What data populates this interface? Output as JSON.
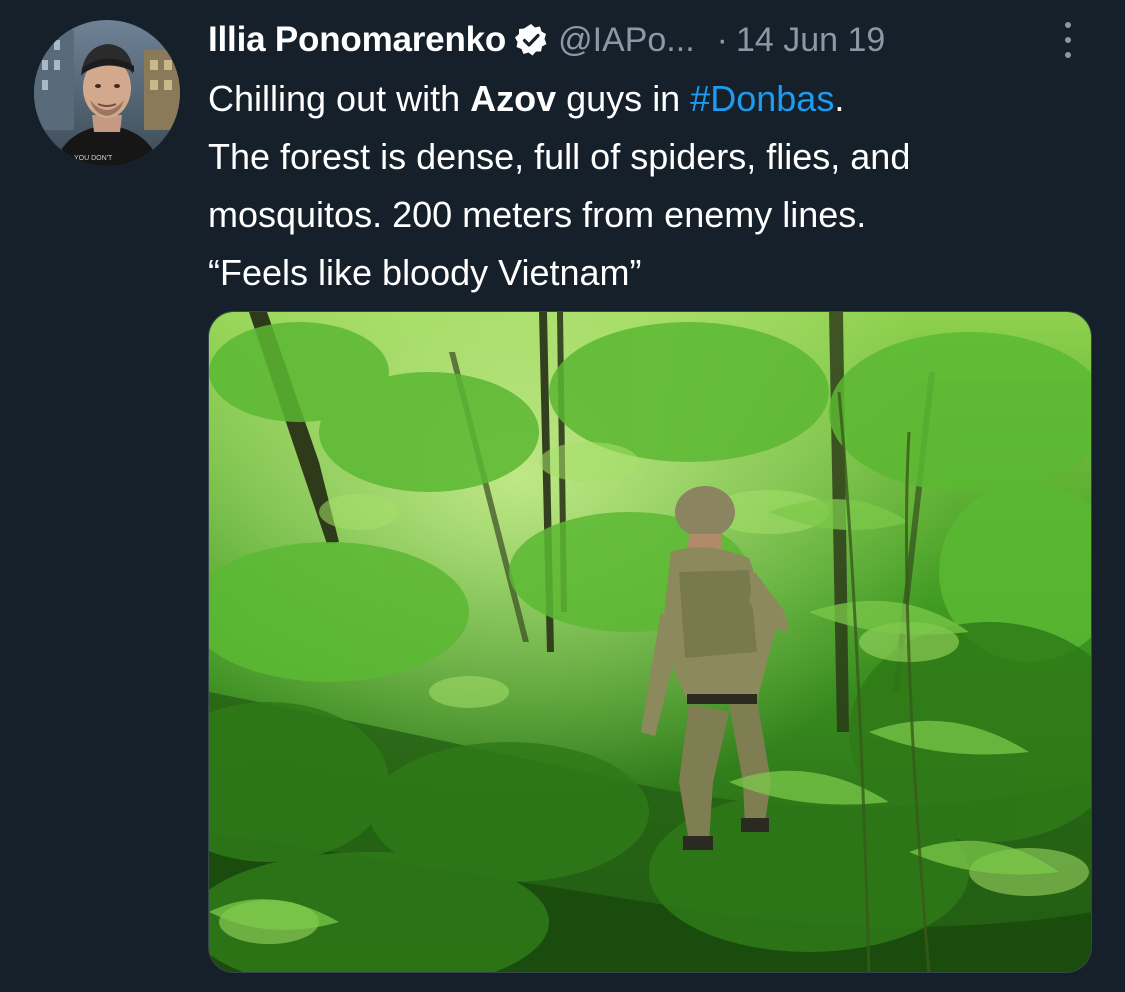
{
  "tweet": {
    "author": {
      "display_name": "Illia Ponomarenko",
      "handle": "@IAPo...",
      "verified": true,
      "avatar_icon": "profile-photo"
    },
    "separator": "·",
    "date": "14 Jun 19",
    "more_icon": "more-vertical-icon",
    "text": {
      "line1_prefix": "Chilling out with ",
      "line1_bold": "Azov",
      "line1_middle": " guys in ",
      "line1_hashtag": "#Donbas",
      "line1_suffix": ".",
      "line2": "The forest is dense, full of spiders, flies, and",
      "line3": "mosquitos. 200 meters from enemy lines.",
      "line4": "“Feels like bloody Vietnam”"
    },
    "media": {
      "type": "photo",
      "icon": "forest-photo"
    }
  },
  "colors": {
    "background": "#15202b",
    "text_primary": "#ffffff",
    "text_secondary": "#8b98a5",
    "link": "#1d9bf0",
    "verified_badge": "#ffffff"
  }
}
